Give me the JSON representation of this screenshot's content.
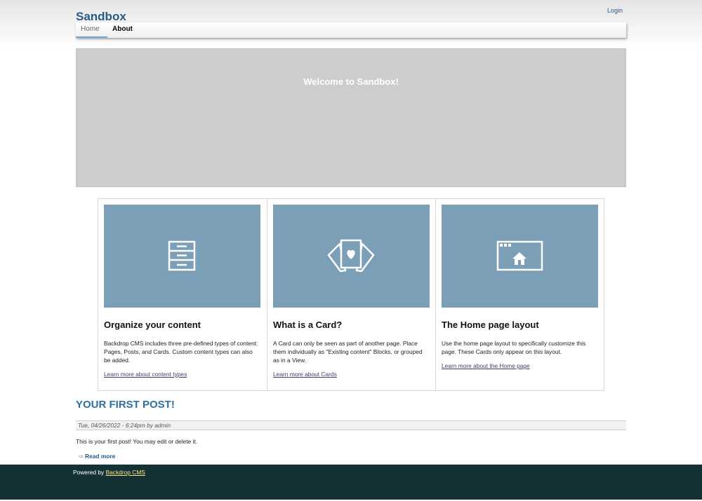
{
  "header": {
    "site_name": "Sandbox",
    "login_label": "Login"
  },
  "menu": {
    "home_label": "Home",
    "about_label": "About"
  },
  "hero": {
    "title": "Welcome to Sandbox!"
  },
  "cards": [
    {
      "icon": "drawers-icon",
      "title": "Organize your content",
      "text": "Backdrop CMS includes three pre-defined types of content: Pages, Posts, and Cards. Custom content types can also be added.",
      "link": "Learn more about content types"
    },
    {
      "icon": "cards-heart-icon",
      "title": "What is a Card?",
      "text": "A Card can only be seen as part of another page. Place them individually as \"Existing content\" Blocks, or grouped as in a View.",
      "link": "Learn more about Cards"
    },
    {
      "icon": "browser-home-icon",
      "title": "The Home page layout",
      "text": "Use the home page layout to specifically customize this page. These Cards only appear on this layout.",
      "link": "Learn more about the Home page"
    }
  ],
  "post": {
    "title": "YOUR FIRST POST!",
    "meta": "Tue, 04/26/2022 - 6:24pm by admin",
    "body": "This is your first post! You may edit or delete it.",
    "read_more": "Read more"
  },
  "footer": {
    "powered_by": "Powered by",
    "cms_link": "Backdrop CMS"
  },
  "colors": {
    "card_image_bg": "#7a9fb7",
    "footer_bg": "#143236",
    "link_accent": "#2a5a8a"
  }
}
